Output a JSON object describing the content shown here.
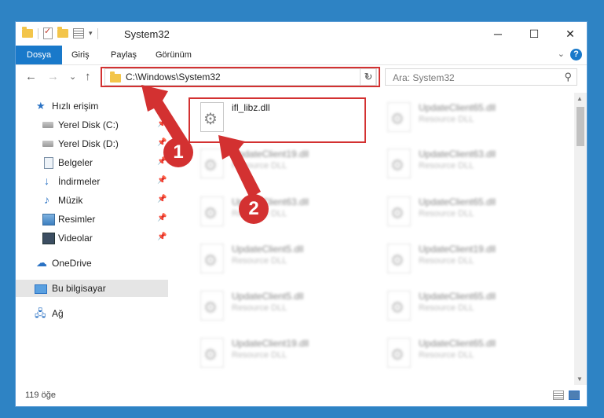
{
  "window": {
    "title": "System32",
    "minimize_glyph": "─",
    "maximize_glyph": "☐",
    "close_glyph": "✕"
  },
  "ribbon": {
    "tabs": [
      "Dosya",
      "Giriş",
      "Paylaş",
      "Görünüm"
    ],
    "expand_glyph": "⌄",
    "help_glyph": "?"
  },
  "nav": {
    "back_glyph": "←",
    "forward_glyph": "→",
    "recent_glyph": "⌄",
    "up_glyph": "↑"
  },
  "address": {
    "path": "C:\\Windows\\System32",
    "dropdown_glyph": "⌄",
    "refresh_glyph": "↻"
  },
  "search": {
    "placeholder": "Ara: System32",
    "icon_glyph": "⚲"
  },
  "sidebar": {
    "items": [
      {
        "label": "Hızlı erişim",
        "icon": "star-icon"
      },
      {
        "label": "Yerel Disk (C:)",
        "icon": "disk-icon"
      },
      {
        "label": "Yerel Disk (D:)",
        "icon": "disk-icon"
      },
      {
        "label": "Belgeler",
        "icon": "document-icon"
      },
      {
        "label": "İndirmeler",
        "icon": "download-icon"
      },
      {
        "label": "Müzik",
        "icon": "music-icon"
      },
      {
        "label": "Resimler",
        "icon": "pictures-icon"
      },
      {
        "label": "Videolar",
        "icon": "video-icon"
      },
      {
        "label": "OneDrive",
        "icon": "cloud-icon"
      },
      {
        "label": "Bu bilgisayar",
        "icon": "computer-icon"
      },
      {
        "label": "Ağ",
        "icon": "network-icon"
      }
    ]
  },
  "files": {
    "highlighted": {
      "name": "ifl_libz.dll"
    },
    "tiles": [
      {
        "name": "UpdateClient65.dll",
        "desc": "Resource DLL"
      },
      {
        "name": "UpdateClient19.dll",
        "desc": "Resource DLL"
      },
      {
        "name": "UpdateClient63.dll",
        "desc": "Resource DLL"
      },
      {
        "name": "UpdateClient63.dll",
        "desc": "Resource DLL"
      },
      {
        "name": "UpdateClient65.dll",
        "desc": "Resource DLL"
      },
      {
        "name": "UpdateClient5.dll",
        "desc": "Resource DLL"
      },
      {
        "name": "UpdateClient19.dll",
        "desc": "Resource DLL"
      },
      {
        "name": "UpdateClient5.dll",
        "desc": "Resource DLL"
      },
      {
        "name": "UpdateClient65.dll",
        "desc": "Resource DLL"
      },
      {
        "name": "UpdateClient19.dll",
        "desc": "Resource DLL"
      },
      {
        "name": "UpdateClient65.dll",
        "desc": "Resource DLL"
      }
    ]
  },
  "status": {
    "count": "119 öğe"
  },
  "markers": {
    "one": "1",
    "two": "2"
  },
  "colors": {
    "accent": "#1979ca",
    "highlight_red": "#d33131"
  }
}
